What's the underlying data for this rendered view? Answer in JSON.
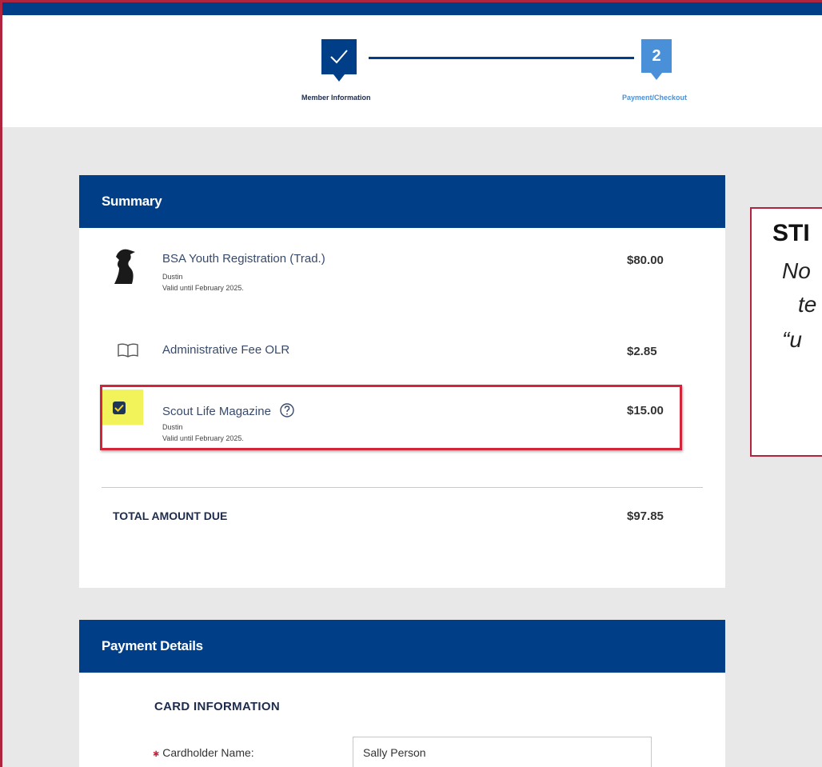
{
  "stepper": {
    "step1_label": "Member Information",
    "step1_icon": "checkmark-icon",
    "step2_number": "2",
    "step2_label": "Payment/Checkout"
  },
  "summary": {
    "header": "Summary",
    "items": [
      {
        "icon": "scout-silhouette-icon",
        "title": "BSA Youth Registration (Trad.)",
        "member": "Dustin",
        "validity": "Valid until February 2025.",
        "price": "$80.00"
      },
      {
        "icon": "book-icon",
        "title": "Administrative Fee OLR",
        "price": "$2.85"
      },
      {
        "icon": "checkbox-checked-icon",
        "title": "Scout Life Magazine",
        "member": "Dustin",
        "validity": "Valid until February 2025.",
        "price": "$15.00",
        "checked": true
      }
    ],
    "total_label": "TOTAL AMOUNT DUE",
    "total_value": "$97.85"
  },
  "callout": {
    "title": "STI",
    "line1": "No",
    "line2": "te",
    "line3": "“u"
  },
  "payment": {
    "header": "Payment Details",
    "section_title": "CARD INFORMATION",
    "cardholder_label": "Cardholder Name:",
    "cardholder_value": "Sally Person"
  },
  "colors": {
    "brand_navy": "#003f87",
    "step_active": "#4a90d9",
    "highlight_red": "#d3253a",
    "highlight_yellow": "#f2f25a"
  }
}
